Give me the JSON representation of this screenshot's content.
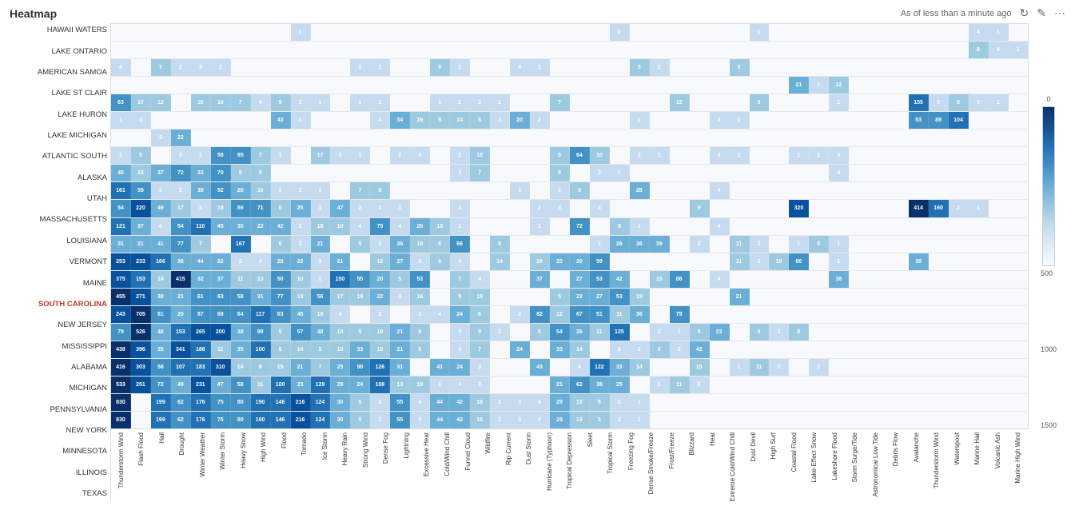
{
  "header": {
    "title": "Heatmap",
    "timestamp": "As of less than a minute ago",
    "refresh_icon": "↻",
    "edit_icon": "✎",
    "more_icon": "⋯"
  },
  "legend": {
    "values": [
      "0",
      "500",
      "1000",
      "1500"
    ]
  },
  "columns": [
    "Thunderstorm Wind",
    "Flash Flood",
    "Hail",
    "Drought",
    "Winter Weather",
    "Winter Storm",
    "Heavy Snow",
    "High Wind",
    "Flood",
    "Tornado",
    "Ice Storm",
    "Heavy Rain",
    "Strong Wind",
    "Dense Fog",
    "Lightning",
    "Excessive Heat",
    "Cold/Wind Chill",
    "Funnel Cloud",
    "Wildfire",
    "Rip Current",
    "Dust Storm",
    "Hurricane (Typhoon)",
    "Tropical Depression",
    "Sleet",
    "Tropical Storm",
    "Freezing Fog",
    "Dense Smoke/Freeze",
    "Frost/Freeze",
    "Blizzard",
    "Heat",
    "Extreme Cold/Wind Chill",
    "Dust Devil",
    "High Surf",
    "Coastal Flood",
    "Lake-Effect Snow",
    "Lakeshore Flood",
    "Storm Surge/Tide",
    "Astronomical Low Tide",
    "Debris Flow",
    "Avalanche",
    "Thunderstorm Wind",
    "Waterspout",
    "Marine Hail",
    "Volcanic Ash",
    "Marine High Wind"
  ],
  "rows": [
    {
      "label": "HAWAII WATERS",
      "highlighted": false,
      "values": [
        0,
        0,
        0,
        0,
        0,
        0,
        0,
        0,
        0,
        1,
        0,
        0,
        0,
        0,
        0,
        0,
        0,
        0,
        0,
        0,
        0,
        0,
        0,
        0,
        0,
        2,
        0,
        0,
        0,
        0,
        0,
        0,
        1,
        0,
        0,
        0,
        0,
        0,
        0,
        0,
        0,
        0,
        0,
        4,
        1,
        0
      ]
    },
    {
      "label": "LAKE ONTARIO",
      "highlighted": false,
      "values": [
        0,
        0,
        0,
        0,
        0,
        0,
        0,
        0,
        0,
        0,
        0,
        0,
        0,
        0,
        0,
        0,
        0,
        0,
        0,
        0,
        0,
        0,
        0,
        0,
        0,
        0,
        0,
        0,
        0,
        0,
        0,
        0,
        0,
        0,
        0,
        0,
        0,
        0,
        0,
        0,
        0,
        0,
        0,
        8,
        4,
        1
      ]
    },
    {
      "label": "AMERICAN SAMOA",
      "highlighted": false,
      "values": [
        4,
        0,
        7,
        2,
        3,
        2,
        0,
        0,
        0,
        0,
        0,
        0,
        1,
        1,
        0,
        0,
        6,
        1,
        0,
        0,
        4,
        1,
        0,
        0,
        0,
        0,
        5,
        1,
        0,
        0,
        0,
        5,
        0,
        0,
        0,
        0,
        0,
        0,
        0,
        0,
        0,
        0,
        0,
        0,
        0,
        0
      ]
    },
    {
      "label": "LAKE ST CLAIR",
      "highlighted": false,
      "values": [
        0,
        0,
        0,
        0,
        0,
        0,
        0,
        0,
        0,
        0,
        0,
        0,
        0,
        0,
        0,
        0,
        0,
        0,
        0,
        0,
        0,
        0,
        0,
        0,
        0,
        0,
        0,
        0,
        0,
        0,
        0,
        0,
        0,
        0,
        21,
        1,
        12,
        0,
        0,
        0,
        0,
        0,
        0,
        0,
        0,
        0
      ]
    },
    {
      "label": "LAKE HURON",
      "highlighted": false,
      "values": [
        63,
        17,
        12,
        0,
        10,
        16,
        7,
        4,
        5,
        2,
        1,
        0,
        1,
        1,
        0,
        0,
        1,
        2,
        2,
        1,
        0,
        0,
        7,
        0,
        0,
        0,
        0,
        0,
        12,
        0,
        0,
        0,
        6,
        0,
        0,
        0,
        1,
        0,
        0,
        0,
        155,
        3,
        5,
        3,
        1,
        0
      ]
    },
    {
      "label": "LAKE MICHIGAN",
      "highlighted": false,
      "values": [
        1,
        1,
        0,
        0,
        0,
        0,
        0,
        0,
        43,
        1,
        0,
        0,
        0,
        4,
        34,
        16,
        9,
        14,
        8,
        3,
        20,
        2,
        0,
        0,
        0,
        0,
        1,
        0,
        0,
        0,
        3,
        1,
        0,
        0,
        0,
        0,
        0,
        0,
        0,
        0,
        53,
        89,
        104,
        0,
        0,
        0
      ]
    },
    {
      "label": "ATLANTIC SOUTH",
      "highlighted": false,
      "values": [
        0,
        0,
        3,
        22,
        0,
        0,
        0,
        0,
        0,
        0,
        0,
        0,
        0,
        0,
        0,
        0,
        0,
        0,
        0,
        0,
        0,
        0,
        0,
        0,
        0,
        0,
        0,
        0,
        0,
        0,
        0,
        0,
        0,
        0,
        0,
        0,
        0,
        0,
        0,
        0,
        0,
        0,
        0,
        0,
        0,
        0
      ]
    },
    {
      "label": "ALASKA",
      "highlighted": false,
      "values": [
        1,
        5,
        0,
        3,
        1,
        58,
        95,
        7,
        1,
        0,
        17,
        3,
        1,
        0,
        2,
        3,
        0,
        2,
        18,
        0,
        0,
        0,
        5,
        64,
        10,
        0,
        2,
        1,
        0,
        0,
        3,
        1,
        0,
        0,
        1,
        1,
        4,
        0,
        0,
        0,
        0,
        0,
        0,
        0,
        0,
        0
      ]
    },
    {
      "label": "UTAH",
      "highlighted": false,
      "values": [
        45,
        15,
        37,
        72,
        33,
        70,
        9,
        5,
        0,
        0,
        0,
        0,
        0,
        0,
        0,
        0,
        0,
        3,
        7,
        0,
        0,
        0,
        9,
        0,
        2,
        1,
        0,
        0,
        0,
        0,
        0,
        0,
        0,
        0,
        0,
        0,
        4,
        0,
        0,
        0,
        0,
        0,
        0,
        0,
        0,
        0
      ]
    },
    {
      "label": "MASSACHUSETTS",
      "highlighted": false,
      "values": [
        161,
        59,
        1,
        2,
        39,
        52,
        26,
        16,
        1,
        2,
        2,
        0,
        7,
        9,
        0,
        0,
        0,
        0,
        0,
        0,
        1,
        0,
        1,
        5,
        0,
        0,
        28,
        0,
        0,
        0,
        4,
        0,
        0,
        0,
        0,
        0,
        0,
        0,
        0,
        0,
        0,
        0,
        0,
        0,
        0,
        0
      ]
    },
    {
      "label": "LOUISIANA",
      "highlighted": false,
      "values": [
        54,
        220,
        49,
        17,
        3,
        19,
        86,
        71,
        6,
        25,
        1,
        47,
        2,
        2,
        1,
        0,
        0,
        3,
        0,
        0,
        0,
        2,
        3,
        0,
        4,
        0,
        0,
        0,
        0,
        9,
        0,
        0,
        0,
        0,
        320,
        0,
        0,
        0,
        0,
        0,
        414,
        160,
        2,
        1,
        0,
        0
      ]
    },
    {
      "label": "VERMONT",
      "highlighted": false,
      "values": [
        121,
        37,
        4,
        54,
        110,
        45,
        30,
        22,
        42,
        2,
        18,
        10,
        4,
        75,
        4,
        20,
        15,
        1,
        0,
        0,
        0,
        1,
        0,
        72,
        0,
        8,
        1,
        0,
        0,
        0,
        4,
        0,
        0,
        0,
        0,
        0,
        0,
        0,
        0,
        0,
        0,
        0,
        0,
        0,
        0,
        0
      ]
    },
    {
      "label": "MAINE",
      "highlighted": false,
      "values": [
        31,
        21,
        41,
        77,
        7,
        0,
        167,
        0,
        6,
        2,
        21,
        0,
        5,
        3,
        36,
        18,
        6,
        66,
        0,
        5,
        0,
        0,
        0,
        0,
        1,
        26,
        36,
        39,
        0,
        2,
        0,
        11,
        2,
        0,
        1,
        5,
        1,
        0,
        0,
        0,
        0,
        0,
        0,
        0,
        0,
        0
      ]
    },
    {
      "label": "SOUTH CAROLINA",
      "highlighted": true,
      "values": [
        253,
        233,
        166,
        36,
        44,
        22,
        2,
        4,
        20,
        22,
        3,
        21,
        0,
        12,
        27,
        3,
        6,
        4,
        0,
        14,
        0,
        16,
        25,
        20,
        59,
        0,
        0,
        0,
        0,
        0,
        0,
        11,
        2,
        15,
        86,
        0,
        1,
        0,
        0,
        0,
        38,
        0,
        0,
        0,
        0,
        0
      ]
    },
    {
      "label": "NEW JERSEY",
      "highlighted": false,
      "values": [
        375,
        153,
        14,
        415,
        32,
        37,
        11,
        13,
        50,
        10,
        3,
        150,
        55,
        20,
        5,
        53,
        0,
        7,
        4,
        0,
        0,
        37,
        0,
        27,
        53,
        42,
        0,
        15,
        86,
        0,
        4,
        0,
        0,
        0,
        0,
        0,
        38,
        0,
        0,
        0,
        0,
        0,
        0,
        0,
        0,
        0
      ]
    },
    {
      "label": "MISSISSIPPI",
      "highlighted": false,
      "values": [
        455,
        271,
        38,
        21,
        61,
        63,
        58,
        31,
        77,
        13,
        56,
        17,
        19,
        22,
        3,
        16,
        0,
        9,
        15,
        0,
        0,
        0,
        5,
        22,
        27,
        53,
        19,
        0,
        0,
        0,
        0,
        21,
        0,
        0,
        0,
        0,
        0,
        0,
        0,
        0,
        0,
        0,
        0,
        0,
        0,
        0
      ]
    },
    {
      "label": "ALABAMA",
      "highlighted": false,
      "values": [
        243,
        705,
        61,
        20,
        87,
        69,
        64,
        117,
        63,
        45,
        19,
        4,
        0,
        2,
        0,
        1,
        4,
        24,
        6,
        0,
        2,
        82,
        12,
        67,
        51,
        11,
        36,
        0,
        79,
        0,
        0,
        0,
        0,
        0,
        0,
        0,
        0,
        0,
        0,
        0,
        0,
        0,
        0,
        0,
        0,
        0
      ]
    },
    {
      "label": "MICHIGAN",
      "highlighted": false,
      "values": [
        79,
        526,
        48,
        153,
        265,
        200,
        38,
        98,
        5,
        57,
        48,
        14,
        5,
        19,
        21,
        6,
        0,
        4,
        9,
        1,
        0,
        5,
        54,
        26,
        11,
        125,
        0,
        2,
        1,
        8,
        23,
        0,
        9,
        3,
        8,
        0,
        0,
        0,
        0,
        0,
        0,
        0,
        0,
        0,
        0,
        0
      ]
    },
    {
      "label": "PENNSYLVANIA",
      "highlighted": false,
      "values": [
        438,
        396,
        35,
        341,
        188,
        11,
        35,
        100,
        5,
        14,
        5,
        13,
        33,
        15,
        21,
        6,
        0,
        4,
        7,
        0,
        24,
        0,
        33,
        14,
        0,
        2,
        1,
        8,
        2,
        42,
        0,
        0,
        0,
        0,
        0,
        0,
        0,
        0,
        0,
        0,
        0,
        0,
        0,
        0,
        0,
        0
      ]
    },
    {
      "label": "NEW YORK",
      "highlighted": false,
      "values": [
        416,
        303,
        58,
        107,
        183,
        310,
        14,
        6,
        15,
        21,
        7,
        25,
        98,
        126,
        31,
        0,
        41,
        24,
        3,
        0,
        0,
        43,
        0,
        4,
        122,
        33,
        14,
        0,
        0,
        15,
        0,
        1,
        11,
        3,
        0,
        2,
        0,
        0,
        0,
        0,
        0,
        0,
        0,
        0,
        0,
        0
      ]
    },
    {
      "label": "MINNESOTA",
      "highlighted": false,
      "values": [
        533,
        251,
        72,
        49,
        231,
        47,
        58,
        11,
        100,
        23,
        129,
        29,
        24,
        108,
        13,
        19,
        1,
        4,
        2,
        0,
        0,
        0,
        21,
        62,
        38,
        25,
        0,
        1,
        11,
        3,
        0,
        0,
        0,
        0,
        0,
        0,
        0,
        0,
        0,
        0,
        0,
        0,
        0,
        0,
        0,
        0
      ]
    },
    {
      "label": "ILLINOIS",
      "highlighted": false,
      "values": [
        830,
        0,
        199,
        62,
        176,
        75,
        80,
        190,
        146,
        216,
        124,
        30,
        5,
        2,
        55,
        4,
        44,
        42,
        16,
        2,
        3,
        4,
        29,
        13,
        5,
        2,
        1,
        0,
        0,
        0,
        0,
        0,
        0,
        0,
        0,
        0,
        0,
        0,
        0,
        0,
        0,
        0,
        0,
        0,
        0,
        0
      ]
    },
    {
      "label": "TEXAS",
      "highlighted": false,
      "values": [
        830,
        0,
        199,
        62,
        176,
        75,
        80,
        190,
        146,
        216,
        124,
        30,
        5,
        2,
        55,
        4,
        44,
        42,
        16,
        2,
        3,
        4,
        29,
        13,
        5,
        2,
        1,
        0,
        0,
        0,
        0,
        0,
        0,
        0,
        0,
        0,
        0,
        0,
        0,
        0,
        0,
        0,
        0,
        0,
        0,
        0
      ]
    }
  ]
}
